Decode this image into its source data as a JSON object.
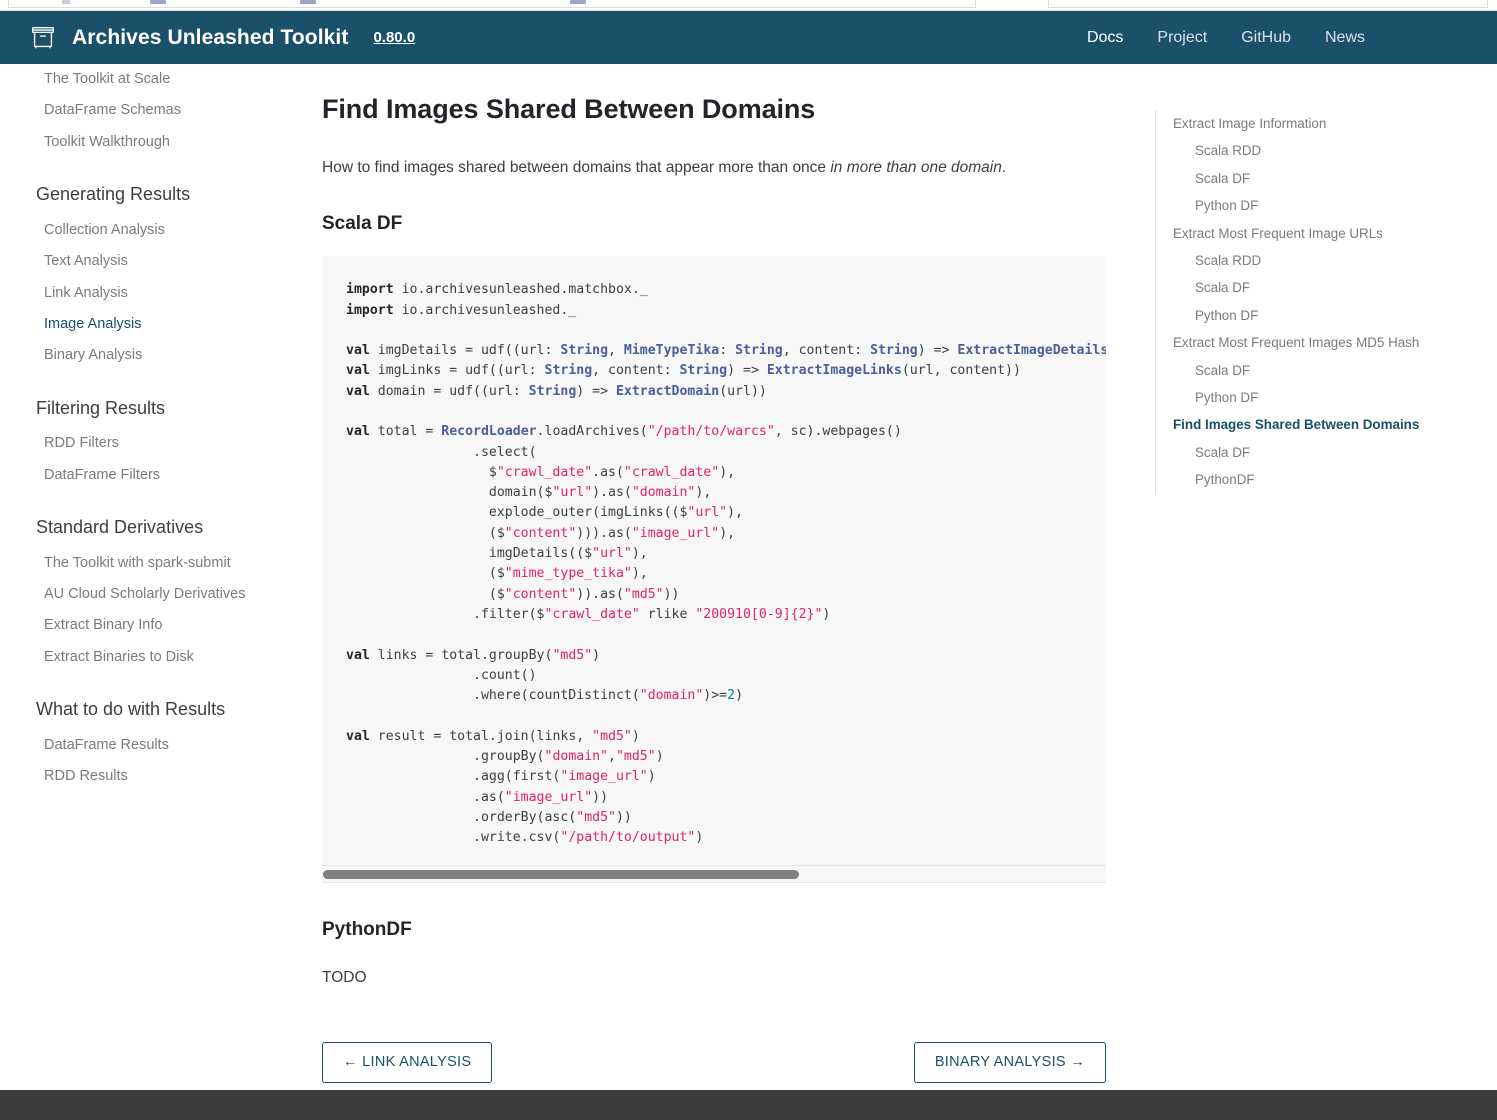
{
  "header": {
    "logo_icon": "archive-box-icon",
    "title": "Archives Unleashed Toolkit",
    "version": "0.80.0",
    "nav": [
      {
        "label": "Docs",
        "active": true
      },
      {
        "label": "Project",
        "active": false
      },
      {
        "label": "GitHub",
        "active": false
      },
      {
        "label": "News",
        "active": false
      }
    ],
    "background_color": "#1a5069"
  },
  "sidebar": {
    "items": [
      {
        "type": "link",
        "label": "The Toolkit at Scale",
        "active": false
      },
      {
        "type": "link",
        "label": "DataFrame Schemas",
        "active": false
      },
      {
        "type": "link",
        "label": "Toolkit Walkthrough",
        "active": false
      },
      {
        "type": "heading",
        "label": "Generating Results"
      },
      {
        "type": "link",
        "label": "Collection Analysis",
        "active": false
      },
      {
        "type": "link",
        "label": "Text Analysis",
        "active": false
      },
      {
        "type": "link",
        "label": "Link Analysis",
        "active": false
      },
      {
        "type": "link",
        "label": "Image Analysis",
        "active": true
      },
      {
        "type": "link",
        "label": "Binary Analysis",
        "active": false
      },
      {
        "type": "heading",
        "label": "Filtering Results"
      },
      {
        "type": "link",
        "label": "RDD Filters",
        "active": false
      },
      {
        "type": "link",
        "label": "DataFrame Filters",
        "active": false
      },
      {
        "type": "heading",
        "label": "Standard Derivatives"
      },
      {
        "type": "link",
        "label": "The Toolkit with spark-submit",
        "active": false
      },
      {
        "type": "link",
        "label": "AU Cloud Scholarly Derivatives",
        "active": false
      },
      {
        "type": "link",
        "label": "Extract Binary Info",
        "active": false
      },
      {
        "type": "link",
        "label": "Extract Binaries to Disk",
        "active": false
      },
      {
        "type": "heading",
        "label": "What to do with Results"
      },
      {
        "type": "link",
        "label": "DataFrame Results",
        "active": false
      },
      {
        "type": "link",
        "label": "RDD Results",
        "active": false
      }
    ]
  },
  "main": {
    "page_title": "Find Images Shared Between Domains",
    "intro_prefix": "How to find images shared between domains that appear more than once ",
    "intro_emphasis": "in more than one domain",
    "intro_suffix": ".",
    "section_scala_df": "Scala DF",
    "section_python_df": "PythonDF",
    "python_df_body": "TODO",
    "code_scala_df": "import io.archivesunleashed.matchbox._\nimport io.archivesunleashed._\n\nval imgDetails = udf((url: String, MimeTypeTika: String, content: String) => ExtractImageDetails(url, MimeTypeTika, content))\nval imgLinks = udf((url: String, content: String) => ExtractImageLinks(url, content))\nval domain = udf((url: String) => ExtractDomain(url))\n\nval total = RecordLoader.loadArchives(\"/path/to/warcs\", sc).webpages()\n                .select(\n                  $\"crawl_date\".as(\"crawl_date\"),\n                  domain($\"url\").as(\"domain\"),\n                  explode_outer(imgLinks(($\"url\"),\n                  ($\"content\"))).as(\"image_url\"),\n                  imgDetails(($\"url\"),\n                  ($\"mime_type_tika\"),\n                  ($\"content\")).as(\"md5\"))\n                .filter($\"crawl_date\" rlike \"200910[0-9]{2}\")\n\nval links = total.groupBy(\"md5\")\n                .count()\n                .where(countDistinct(\"domain\")>=2)\n\nval result = total.join(links, \"md5\")\n                .groupBy(\"domain\",\"md5\")\n                .agg(first(\"image_url\")\n                .as(\"image_url\"))\n                .orderBy(asc(\"md5\"))\n                .write.csv(\"/path/to/output\")"
  },
  "pager": {
    "prev_label": "← LINK ANALYSIS",
    "next_label": "BINARY ANALYSIS →"
  },
  "toc": {
    "items": [
      {
        "label": "Extract Image Information",
        "level": 1,
        "active": false
      },
      {
        "label": "Scala RDD",
        "level": 2,
        "active": false
      },
      {
        "label": "Scala DF",
        "level": 2,
        "active": false
      },
      {
        "label": "Python DF",
        "level": 2,
        "active": false
      },
      {
        "label": "Extract Most Frequent Image URLs",
        "level": 1,
        "active": false
      },
      {
        "label": "Scala RDD",
        "level": 2,
        "active": false
      },
      {
        "label": "Scala DF",
        "level": 2,
        "active": false
      },
      {
        "label": "Python DF",
        "level": 2,
        "active": false
      },
      {
        "label": "Extract Most Frequent Images MD5 Hash",
        "level": 1,
        "active": false
      },
      {
        "label": "Scala DF",
        "level": 2,
        "active": false
      },
      {
        "label": "Python DF",
        "level": 2,
        "active": false
      },
      {
        "label": "Find Images Shared Between Domains",
        "level": 1,
        "active": true
      },
      {
        "label": "Scala DF",
        "level": 2,
        "active": false
      },
      {
        "label": "PythonDF",
        "level": 2,
        "active": false
      }
    ]
  },
  "colors": {
    "accent": "#1a5069",
    "code_bg": "#f7f7f7",
    "footer": "#3d3d3d",
    "muted_text": "#7b7b7b"
  }
}
